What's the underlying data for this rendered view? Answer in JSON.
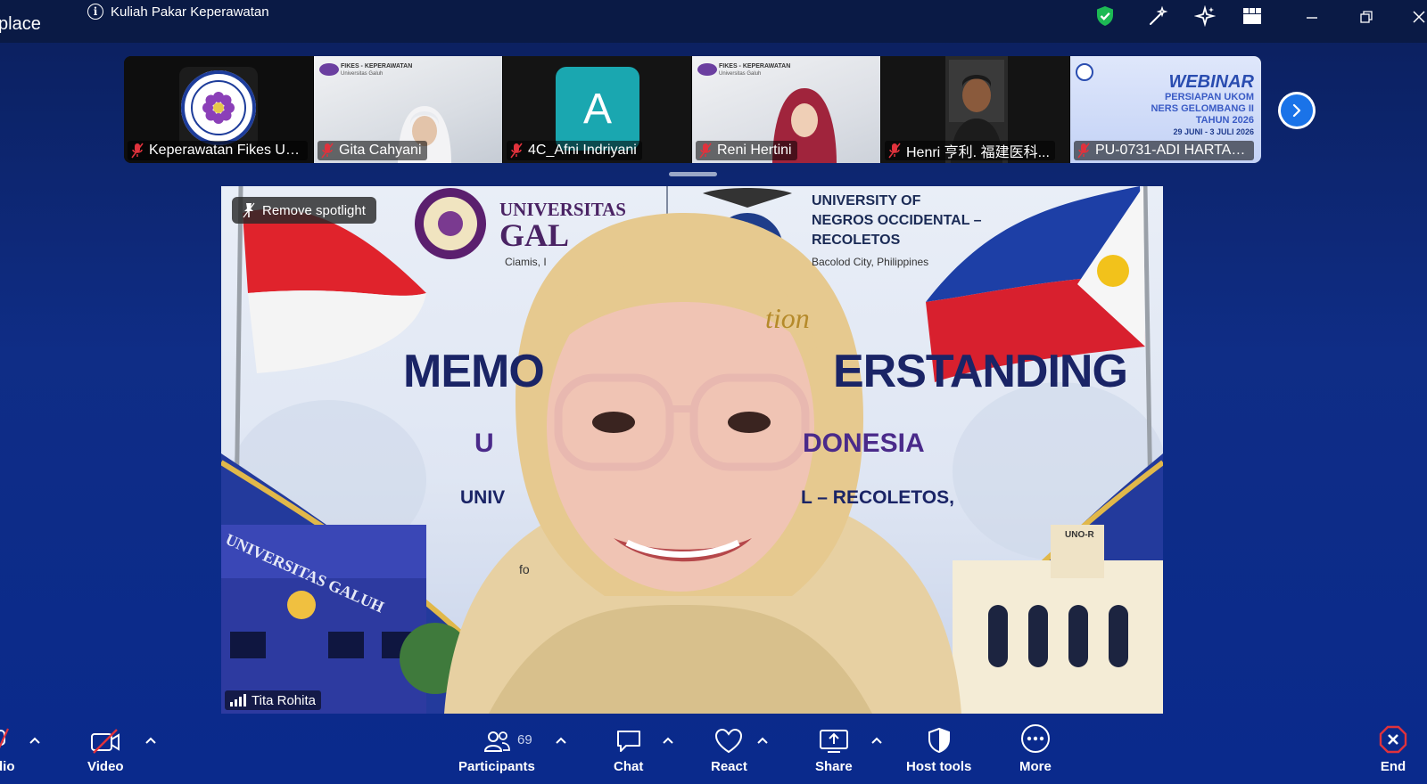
{
  "app": {
    "name_fragment": "place"
  },
  "meeting": {
    "title": "Kuliah Pakar Keperawatan"
  },
  "participants_strip": [
    {
      "name": "Keperawatan Fikes Uni...",
      "muted": true
    },
    {
      "name": "Gita Cahyani",
      "muted": true
    },
    {
      "name": "4C_Afni Indriyani",
      "muted": true,
      "avatar_letter": "A"
    },
    {
      "name": "Reni Hertini",
      "muted": true
    },
    {
      "name": "Henri 亨利. 福建医科...",
      "muted": true
    },
    {
      "name": "PU-0731-ADI HARTADI...",
      "muted": true
    }
  ],
  "thumb_overlays": {
    "fikes_label": "FIKES - KEPERAWATAN",
    "fikes_sub": "Universitas Galuh",
    "webinar_title": "WEBINAR",
    "webinar_sub1": "PERSIAPAN UKOM",
    "webinar_sub2": "NERS GELOMBANG II",
    "webinar_sub3": "TAHUN 2026",
    "webinar_date": "29 JUNI - 3 JULI 2026"
  },
  "main_video": {
    "spotlight_label": "Remove spotlight",
    "speaker_name": "Tita Rohita",
    "banner": {
      "uni1_a": "UNIVERSITAS",
      "uni1_b": "GAL",
      "uni1_city": "Ciamis, I",
      "uni2_a": "UNIVERSITY OF",
      "uni2_b": "NEGROS OCCIDENTAL –",
      "uni2_c": "RECOLETOS",
      "uni2_city": "Bacolod City, Philippines",
      "script_word": "tion",
      "mou_left": "MEMO",
      "mou_right": "ERSTANDING",
      "line2_left": "U",
      "line2_right": "DONESIA",
      "line3_left": "UNIV",
      "line3_right": "L – RECOLETOS,",
      "line4_left": "fo",
      "building_left": "UNIVERSITAS GALUH",
      "building_right": "UNO-R"
    }
  },
  "toolbar": {
    "audio_label": "dio",
    "video_label": "Video",
    "participants_label": "Participants",
    "participants_count": "69",
    "chat_label": "Chat",
    "react_label": "React",
    "share_label": "Share",
    "host_tools_label": "Host tools",
    "more_label": "More",
    "end_label": "End"
  },
  "colors": {
    "accent_blue": "#1a73e8",
    "muted_red": "#e0323c",
    "end_red": "#e0323c",
    "shield_green": "#1db954"
  }
}
